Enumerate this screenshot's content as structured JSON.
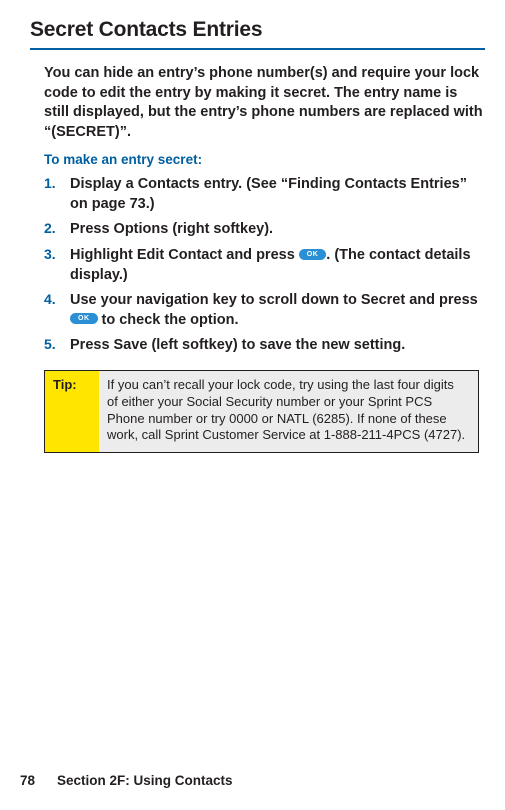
{
  "title": "Secret Contacts Entries",
  "intro": "You can hide an entry’s phone number(s) and require your lock code to edit the entry by making it secret. The entry name is still displayed, but the entry’s phone numbers are replaced with “(SECRET)”.",
  "subhead": "To make an entry secret:",
  "ok_label": "OK",
  "steps": [
    {
      "num": "1.",
      "pre": "Display a Contacts entry. (See “Finding Contacts Entries” on page 73.)"
    },
    {
      "num": "2.",
      "pre": "Press ",
      "bold1": "Options",
      "post1": " (right softkey)."
    },
    {
      "num": "3.",
      "pre": "Highlight ",
      "bold1": "Edit Contact",
      "mid1": " and press ",
      "post1": ". (The contact details display.)"
    },
    {
      "num": "4.",
      "pre": "Use your navigation key to scroll down to ",
      "bold1": "Secret",
      "mid1": " and press ",
      "post1": " to check the option."
    },
    {
      "num": "5.",
      "pre": "Press ",
      "bold1": "Save",
      "post1": " (left softkey) to save the new setting."
    }
  ],
  "tip_label": "Tip:",
  "tip_body": "If you can’t recall your lock code, try using the last four digits of either your Social Security number or your Sprint PCS Phone number or try 0000 or NATL (6285). If none of these work, call Sprint Customer Service at 1-888-211-4PCS (4727).",
  "footer_page": "78",
  "footer_text": "Section 2F: Using Contacts"
}
